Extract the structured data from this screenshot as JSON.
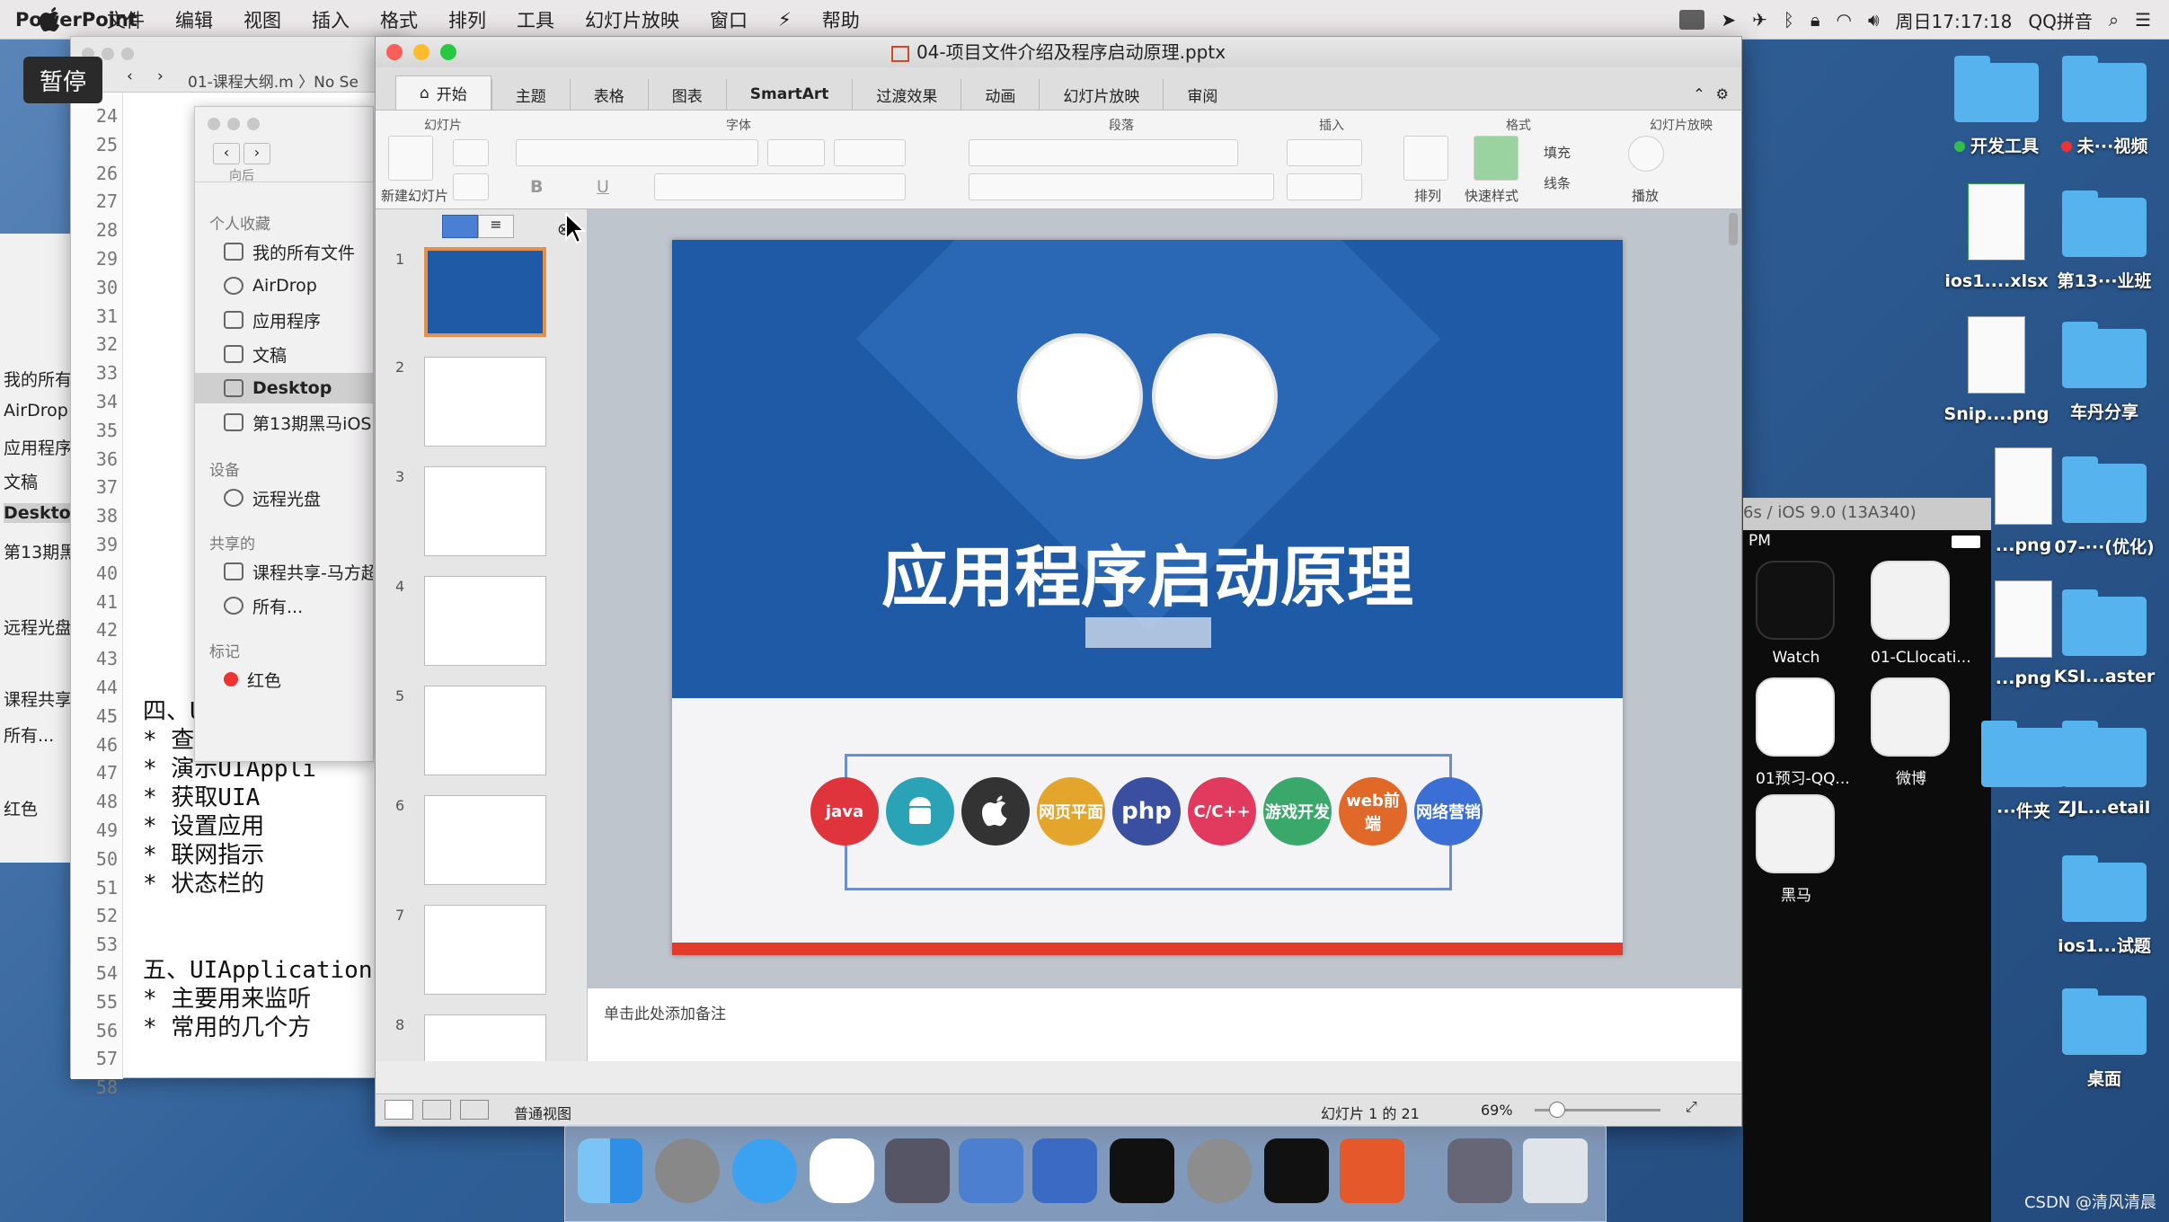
{
  "menubar": {
    "app": "PowerPoint",
    "items": [
      "文件",
      "编辑",
      "视图",
      "插入",
      "格式",
      "排列",
      "工具",
      "幻灯片放映",
      "窗口",
      "帮助"
    ],
    "clock": "周日17:17:18",
    "input_method": "QQ拼音"
  },
  "overlay": {
    "pause_label": "暂停"
  },
  "editor": {
    "path": "01-课程大纲.m 〉No Se",
    "line_numbers": [
      "24",
      "25",
      "26",
      "27",
      "28",
      "29",
      "30",
      "31",
      "32",
      "33",
      "34",
      "35",
      "36",
      "37",
      "38",
      "39",
      "40",
      "41",
      "42",
      "43",
      "44",
      "45",
      "46",
      "47",
      "48",
      "49",
      "50",
      "51",
      "52",
      "53",
      "54",
      "55",
      "56",
      "57",
      "58"
    ],
    "code_lines": [
      {
        "line": "45",
        "text": "四、U"
      },
      {
        "line": "46",
        "text": "  * 查看UIAppli"
      },
      {
        "line": "47",
        "text": "  * 演示UIAppli"
      },
      {
        "line": "48",
        "text": "    * 获取UIA"
      },
      {
        "line": "49",
        "text": "    * 设置应用"
      },
      {
        "line": "50",
        "text": "    * 联网指示"
      },
      {
        "line": "51",
        "text": "    * 状态栏的"
      },
      {
        "line": "54",
        "text": "五、UIApplication"
      },
      {
        "line": "55",
        "text": "  * 主要用来监听"
      },
      {
        "line": "56",
        "text": "  * 常用的几个方"
      }
    ]
  },
  "finder": {
    "back_label": "向后",
    "sections": {
      "favorites": "个人收藏",
      "devices": "设备",
      "shared": "共享的",
      "tags": "标记"
    },
    "favorites": [
      "我的所有文件",
      "AirDrop",
      "应用程序",
      "文稿",
      "Desktop",
      "第13期黑马iOS"
    ],
    "devices": [
      "远程光盘"
    ],
    "shared": [
      "课程共享-马方超",
      "所有..."
    ],
    "tags": [
      "红色"
    ]
  },
  "finder_left": {
    "items": [
      "我的所有",
      "AirDrop",
      "应用程序",
      "文稿",
      "Desktop",
      "第13期黑",
      "远程光盘",
      "课程共享",
      "所有...",
      "红色"
    ]
  },
  "ppt": {
    "window_title": "04-项目文件介绍及程序启动原理.pptx",
    "tabs": [
      "开始",
      "主题",
      "表格",
      "图表",
      "SmartArt",
      "过渡效果",
      "动画",
      "幻灯片放映",
      "审阅"
    ],
    "ribbon_groups": [
      "幻灯片",
      "字体",
      "段落",
      "插入",
      "格式",
      "幻灯片放映"
    ],
    "ribbon_labels": {
      "new_slide": "新建幻灯片",
      "arrange": "排列",
      "quick_styles": "快速样式",
      "fill": "填充",
      "line": "线条",
      "play": "播放"
    },
    "thumbnails": [
      "1",
      "2",
      "3",
      "4",
      "5",
      "6",
      "7",
      "8"
    ],
    "slide": {
      "title": "应用程序启动原理",
      "icons": [
        "java",
        "",
        "",
        "网页平面",
        "php",
        "C/C++",
        "游戏开发",
        "web前端",
        "网络营销"
      ]
    },
    "notes_placeholder": "单击此处添加备注",
    "status": {
      "view": "普通视图",
      "slide_count": "幻灯片 1 的 21",
      "zoom": "69%"
    }
  },
  "simulator": {
    "header": "6s / iOS 9.0 (13A340)",
    "time": "PM",
    "apps": [
      "Watch",
      "01-CLlocati...",
      "01预习-QQ...",
      "微博",
      "黑马"
    ]
  },
  "desktop": {
    "icons": [
      {
        "label": "开发工具",
        "type": "folder",
        "tag": "green"
      },
      {
        "label": "未···视频",
        "type": "folder",
        "tag": "red"
      },
      {
        "label": "ios1....xlsx",
        "type": "file"
      },
      {
        "label": "第13···业班",
        "type": "folder"
      },
      {
        "label": "Snip....png",
        "type": "file"
      },
      {
        "label": "车丹分享",
        "type": "folder"
      },
      {
        "label": "...png",
        "type": "file"
      },
      {
        "label": "07-···(优化)",
        "type": "folder"
      },
      {
        "label": "...png",
        "type": "file"
      },
      {
        "label": "KSI...aster",
        "type": "folder"
      },
      {
        "label": "···件夹",
        "type": "folder"
      },
      {
        "label": "ZJL...etail",
        "type": "folder"
      },
      {
        "label": "ios1...试题",
        "type": "folder"
      },
      {
        "label": "桌面",
        "type": "folder"
      }
    ]
  },
  "watermark": "CSDN @清风清晨",
  "colors": {
    "slide_blue": "#1f5aa6",
    "accent_red": "#e23b2c",
    "thumb_select": "#e6914b"
  }
}
